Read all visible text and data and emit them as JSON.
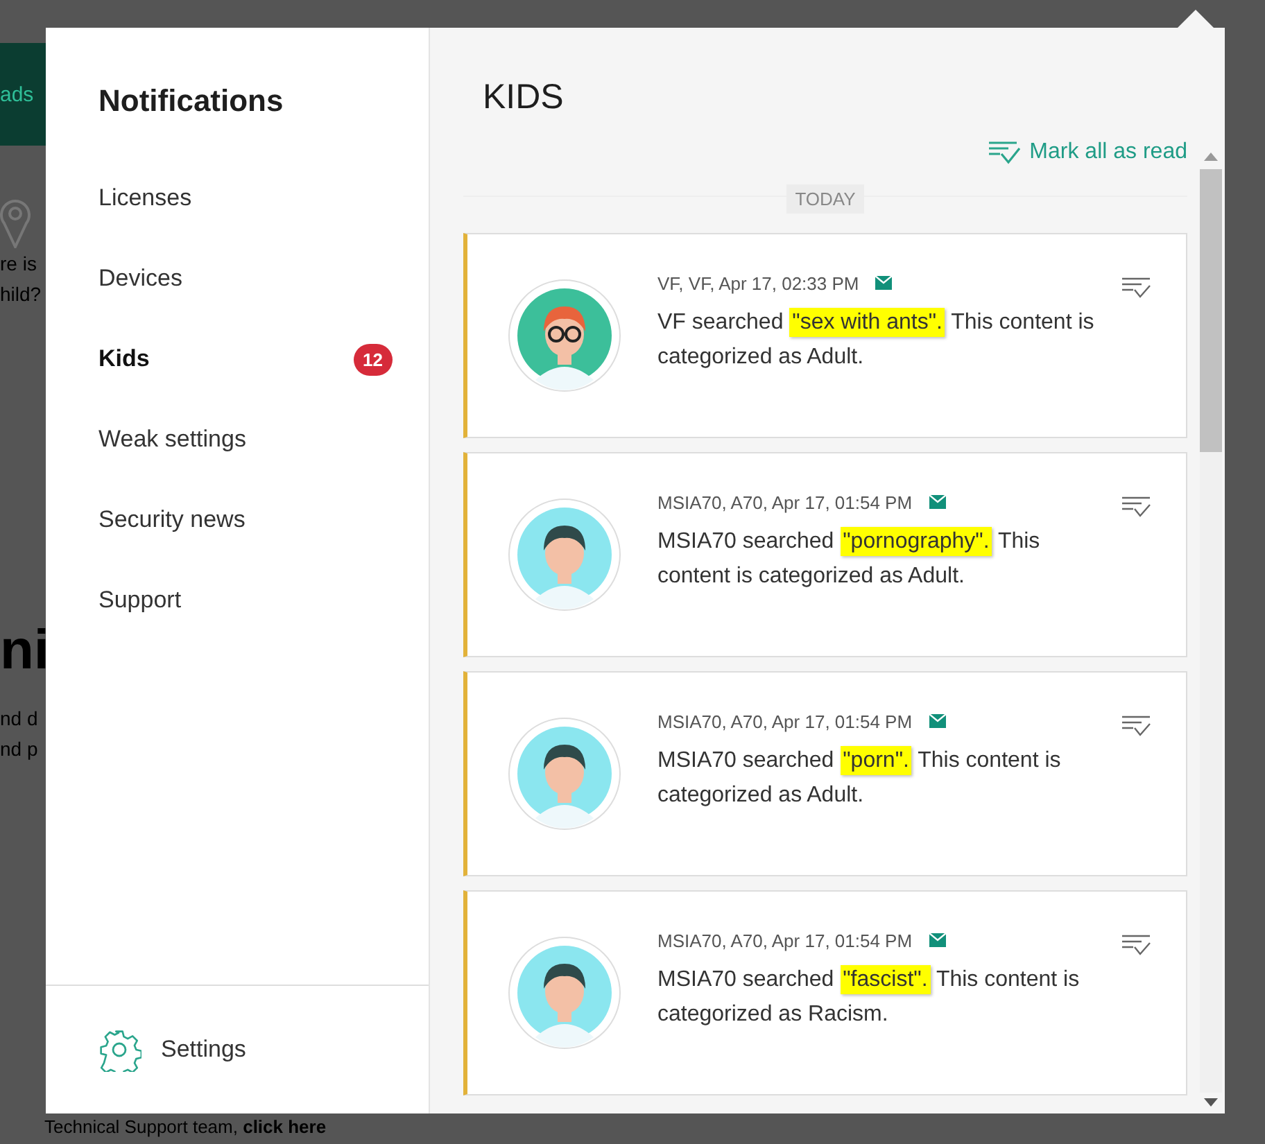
{
  "backdrop": {
    "header_text": "ads",
    "question_lines": [
      "re is",
      "hild?"
    ],
    "heading": "ni",
    "body_lines": [
      "nd d",
      "nd p"
    ],
    "footer_text": "Technical Support team,",
    "footer_link": "click here"
  },
  "sidebar": {
    "title": "Notifications",
    "items": [
      {
        "label": "Licenses",
        "selected": false
      },
      {
        "label": "Devices",
        "selected": false
      },
      {
        "label": "Kids",
        "selected": true,
        "badge": "12"
      },
      {
        "label": "Weak settings",
        "selected": false
      },
      {
        "label": "Security news",
        "selected": false
      },
      {
        "label": "Support",
        "selected": false
      }
    ],
    "settings": "Settings"
  },
  "content": {
    "title": "KIDS",
    "mark_all": "Mark all as read",
    "date_label": "TODAY",
    "notifications": [
      {
        "color": "#3cbf9a",
        "kind": "glasses",
        "meta": "VF, VF, Apr 17, 02:33 PM",
        "text_before": "VF searched",
        "query": "\"sex with ants\".",
        "text_after": "This content is categorized as Adult."
      },
      {
        "color": "#8be6ef",
        "kind": "plain",
        "meta": "MSIA70, A70, Apr 17, 01:54 PM",
        "text_before": "MSIA70 searched",
        "query": "\"pornography\".",
        "text_after": "This content is categorized as Adult."
      },
      {
        "color": "#8be6ef",
        "kind": "plain",
        "meta": "MSIA70, A70, Apr 17, 01:54 PM",
        "text_before": "MSIA70 searched",
        "query": "\"porn\".",
        "text_after": "This content is categorized as Adult."
      },
      {
        "color": "#8be6ef",
        "kind": "plain",
        "meta": "MSIA70, A70, Apr 17, 01:54 PM",
        "text_before": "MSIA70 searched",
        "query": "\"fascist\".",
        "text_after": "This content is categorized as Racism."
      }
    ]
  }
}
